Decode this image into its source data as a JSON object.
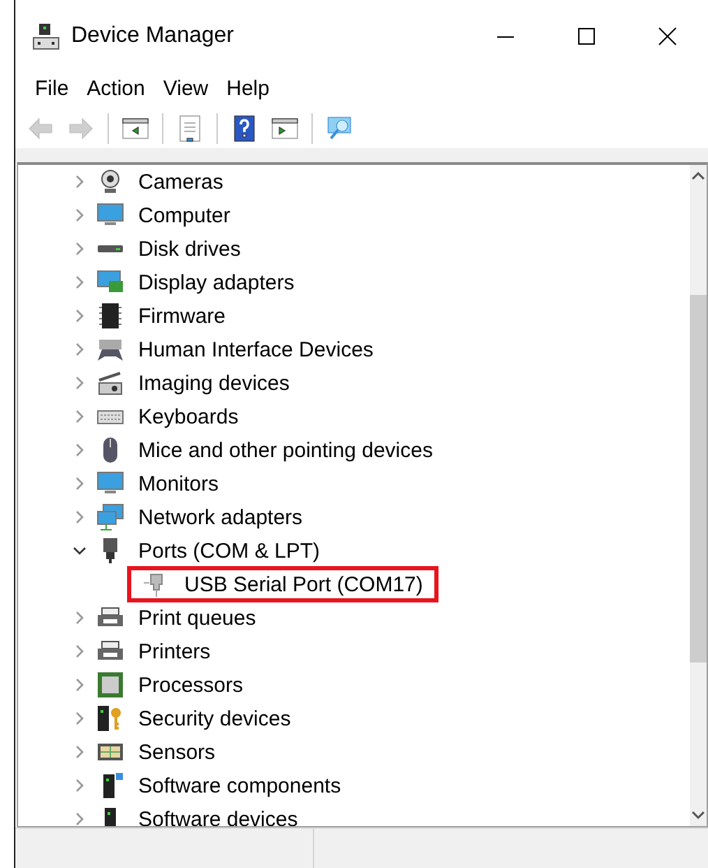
{
  "window": {
    "title": "Device Manager"
  },
  "menu": [
    {
      "label": "File"
    },
    {
      "label": "Action"
    },
    {
      "label": "View"
    },
    {
      "label": "Help"
    }
  ],
  "toolbar": [
    {
      "disabled": true
    },
    {
      "disabled": true
    },
    {
      "disabled": false
    },
    {
      "disabled": false
    },
    {
      "disabled": false
    },
    {
      "disabled": false
    },
    {
      "disabled": false
    }
  ],
  "tree": [
    {
      "label": "Cameras",
      "expanded": false
    },
    {
      "label": "Computer",
      "expanded": false
    },
    {
      "label": "Disk drives",
      "expanded": false
    },
    {
      "label": "Display adapters",
      "expanded": false
    },
    {
      "label": "Firmware",
      "expanded": false
    },
    {
      "label": "Human Interface Devices",
      "expanded": false
    },
    {
      "label": "Imaging devices",
      "expanded": false
    },
    {
      "label": "Keyboards",
      "expanded": false
    },
    {
      "label": "Mice and other pointing devices",
      "expanded": false
    },
    {
      "label": "Monitors",
      "expanded": false
    },
    {
      "label": "Network adapters",
      "expanded": false
    },
    {
      "label": "Ports (COM & LPT)",
      "expanded": true,
      "children": [
        {
          "label": "USB Serial Port (COM17)",
          "highlighted": true
        }
      ]
    },
    {
      "label": "Print queues",
      "expanded": false
    },
    {
      "label": "Printers",
      "expanded": false
    },
    {
      "label": "Processors",
      "expanded": false
    },
    {
      "label": "Security devices",
      "expanded": false
    },
    {
      "label": "Sensors",
      "expanded": false
    },
    {
      "label": "Software components",
      "expanded": false
    },
    {
      "label": "Software devices",
      "expanded": false
    }
  ]
}
